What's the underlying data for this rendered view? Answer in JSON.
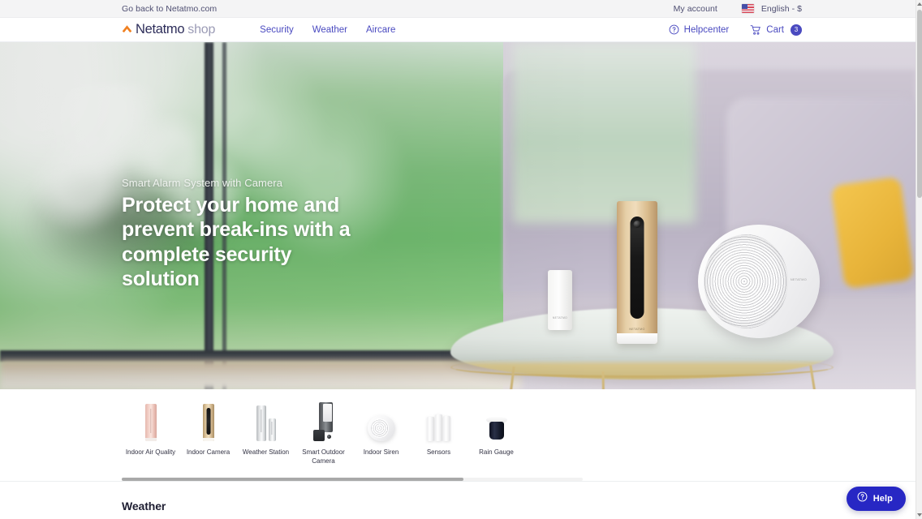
{
  "topbar": {
    "back_link": "Go back to Netatmo.com",
    "account_link": "My account",
    "language": "English - $",
    "flag_icon": "us-flag-icon"
  },
  "nav": {
    "logo_name": "Netatmo",
    "logo_shop": "shop",
    "links": [
      {
        "label": "Security"
      },
      {
        "label": "Weather"
      },
      {
        "label": "Aircare"
      }
    ],
    "helpcenter": "Helpcenter",
    "cart_label": "Cart",
    "cart_count": "3",
    "accent_color": "#4a4ac0"
  },
  "hero": {
    "eyebrow": "Smart Alarm System with Camera",
    "title": "Protect your home and prevent break-ins with a complete security solution"
  },
  "categories": {
    "items": [
      {
        "label": "Indoor Air Quality",
        "icon": "indoor-air-quality-icon"
      },
      {
        "label": "Indoor Camera",
        "icon": "indoor-camera-icon"
      },
      {
        "label": "Weather Station",
        "icon": "weather-station-icon"
      },
      {
        "label": "Smart Outdoor Camera",
        "icon": "smart-outdoor-camera-icon"
      },
      {
        "label": "Indoor Siren",
        "icon": "indoor-siren-icon"
      },
      {
        "label": "Sensors",
        "icon": "sensors-icon"
      },
      {
        "label": "Rain Gauge",
        "icon": "rain-gauge-icon"
      }
    ]
  },
  "weather_section": {
    "title": "Weather"
  },
  "help": {
    "label": "Help",
    "icon": "question-circle-icon",
    "color": "#2727c4"
  }
}
